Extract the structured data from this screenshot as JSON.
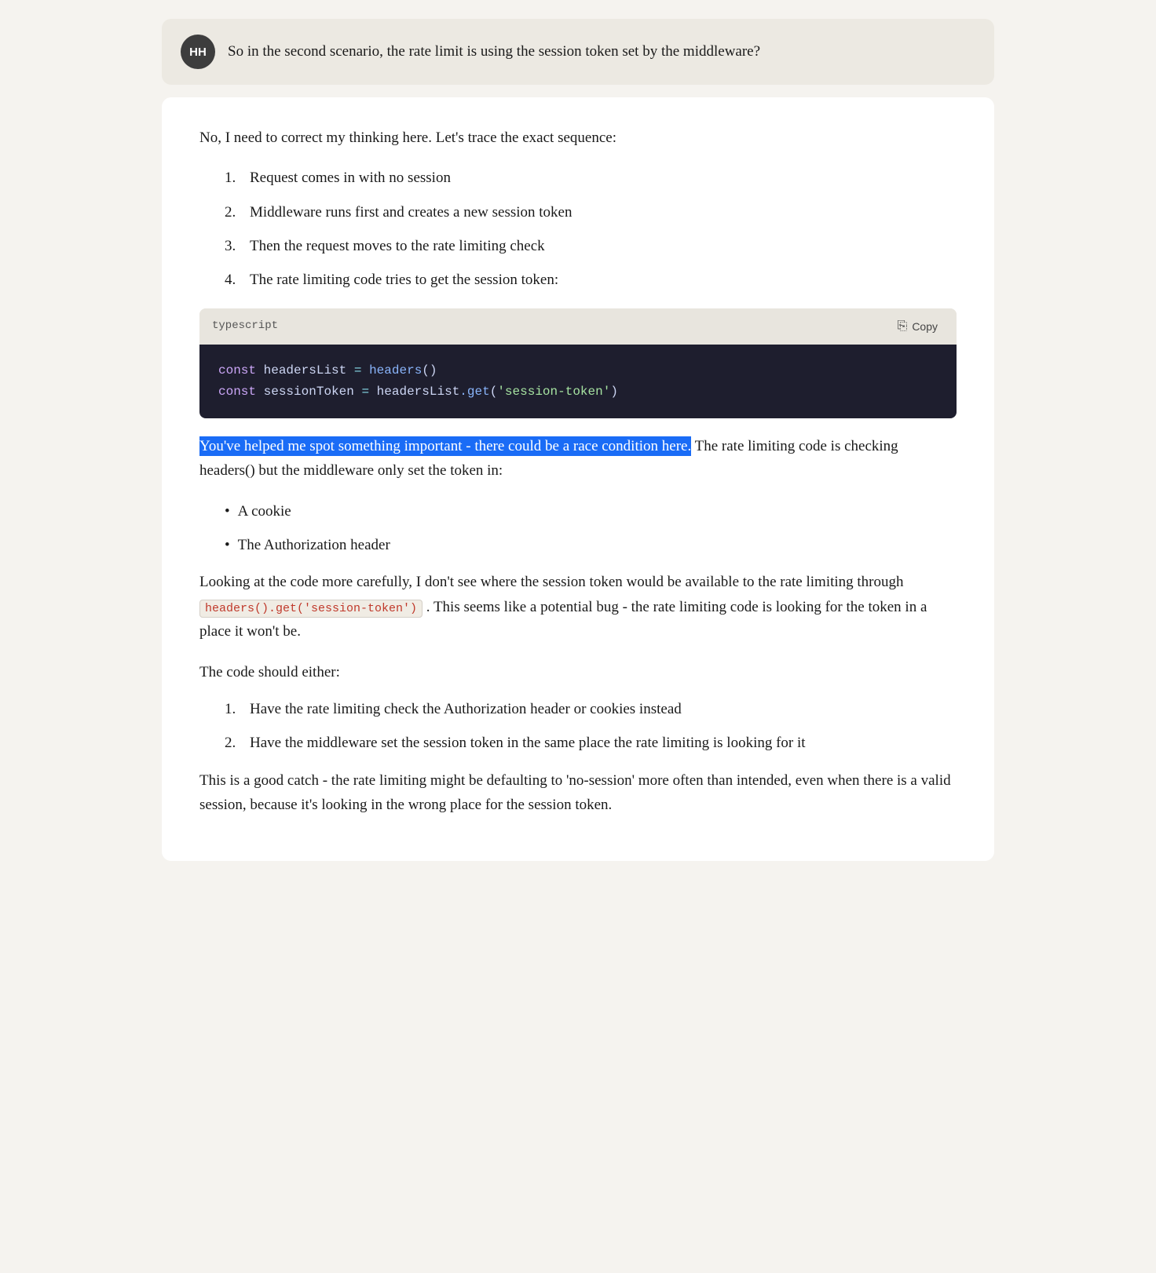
{
  "user": {
    "initials": "HH",
    "message": "So in the second scenario, the rate limit is using the session token set by the middleware?"
  },
  "response": {
    "intro": "No, I need to correct my thinking here. Let's trace the exact sequence:",
    "steps": [
      "Request comes in with no session",
      "Middleware runs first and creates a new session token",
      "Then the request moves to the rate limiting check",
      "The rate limiting code tries to get the session token:"
    ],
    "code": {
      "language": "typescript",
      "copy_label": "Copy",
      "line1_kw": "const",
      "line1_var": "headersList",
      "line1_op": "=",
      "line1_fn": "headers",
      "line1_parens": "()",
      "line2_kw": "const",
      "line2_var": "sessionToken",
      "line2_op": "=",
      "line2_obj": "headersList",
      "line2_method": ".get",
      "line2_arg": "'session-token'"
    },
    "highlighted_sentence": "You've helped me spot something important - there could be a race condition here.",
    "after_highlight": " The rate limiting code is checking headers() but the middleware only set the token in:",
    "bullet_points": [
      "A cookie",
      "The Authorization header"
    ],
    "paragraph2": "Looking at the code more carefully, I don't see where the session token would be available to the rate limiting through",
    "inline_code": "headers().get('session-token')",
    "paragraph2_after": ". This seems like a potential bug - the rate limiting code is looking for the token in a place it won't be.",
    "paragraph3": "The code should either:",
    "fix_steps": [
      "Have the rate limiting check the Authorization header or cookies instead",
      "Have the middleware set the session token in the same place the rate limiting is looking for it"
    ],
    "paragraph4": "This is a good catch - the rate limiting might be defaulting to 'no-session' more often than intended, even when there is a valid session, because it's looking in the wrong place for the session token."
  }
}
